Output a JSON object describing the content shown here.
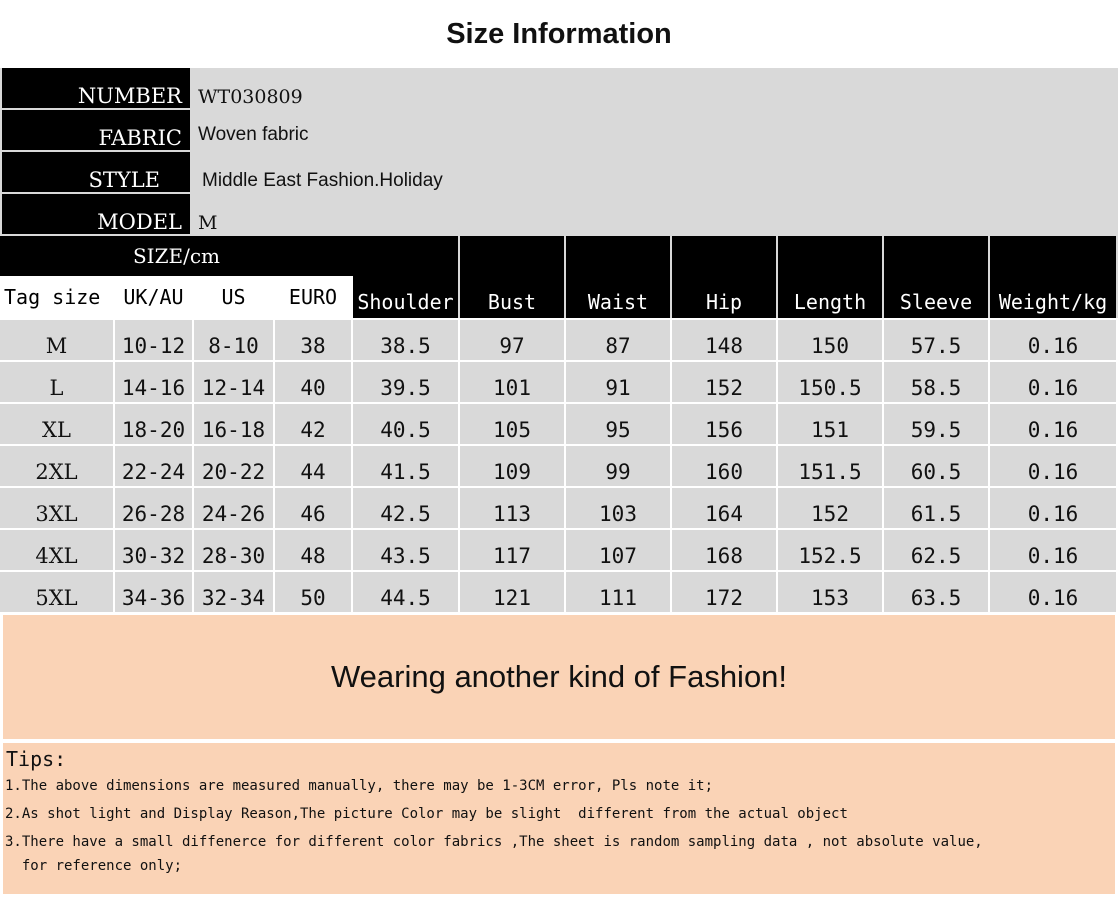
{
  "title": "Size Information",
  "info": [
    {
      "key": "NUMBER",
      "value": "WT030809",
      "font": "serif"
    },
    {
      "key": "FABRIC",
      "value": "Woven fabric",
      "font": "sans"
    },
    {
      "key": "STYLE",
      "value": "Middle East Fashion.Holiday",
      "font": "sans"
    },
    {
      "key": "MODEL",
      "value": "M",
      "font": "serif"
    }
  ],
  "size_unit": "SIZE/cm",
  "columns": [
    "Tag size",
    "UK/AU",
    "US",
    "EURO",
    "Shoulder",
    "Bust",
    "Waist",
    "Hip",
    "Length",
    "Sleeve",
    "Weight/kg"
  ],
  "rows": [
    [
      "M",
      "10-12",
      "8-10",
      "38",
      "38.5",
      "97",
      "87",
      "148",
      "150",
      "57.5",
      "0.16"
    ],
    [
      "L",
      "14-16",
      "12-14",
      "40",
      "39.5",
      "101",
      "91",
      "152",
      "150.5",
      "58.5",
      "0.16"
    ],
    [
      "XL",
      "18-20",
      "16-18",
      "42",
      "40.5",
      "105",
      "95",
      "156",
      "151",
      "59.5",
      "0.16"
    ],
    [
      "2XL",
      "22-24",
      "20-22",
      "44",
      "41.5",
      "109",
      "99",
      "160",
      "151.5",
      "60.5",
      "0.16"
    ],
    [
      "3XL",
      "26-28",
      "24-26",
      "46",
      "42.5",
      "113",
      "103",
      "164",
      "152",
      "61.5",
      "0.16"
    ],
    [
      "4XL",
      "30-32",
      "28-30",
      "48",
      "43.5",
      "117",
      "107",
      "168",
      "152.5",
      "62.5",
      "0.16"
    ],
    [
      "5XL",
      "34-36",
      "32-34",
      "50",
      "44.5",
      "121",
      "111",
      "172",
      "153",
      "63.5",
      "0.16"
    ]
  ],
  "banner": "Wearing another kind of Fashion!",
  "tips": {
    "heading": "Tips:",
    "items": [
      "1.The above dimensions are measured manually, there may be 1-3CM error, Pls note it;",
      "2.As shot light and Display Reason,The picture Color may be slight  different from the actual object",
      "3.There have a small diffenerce for different color fabrics ,The sheet is random sampling data , not absolute value,",
      "  for reference only;"
    ]
  },
  "colors": {
    "header_bg": "#000000",
    "grid_bg": "#d9d9d9",
    "banner_bg": "#fad3b6"
  }
}
